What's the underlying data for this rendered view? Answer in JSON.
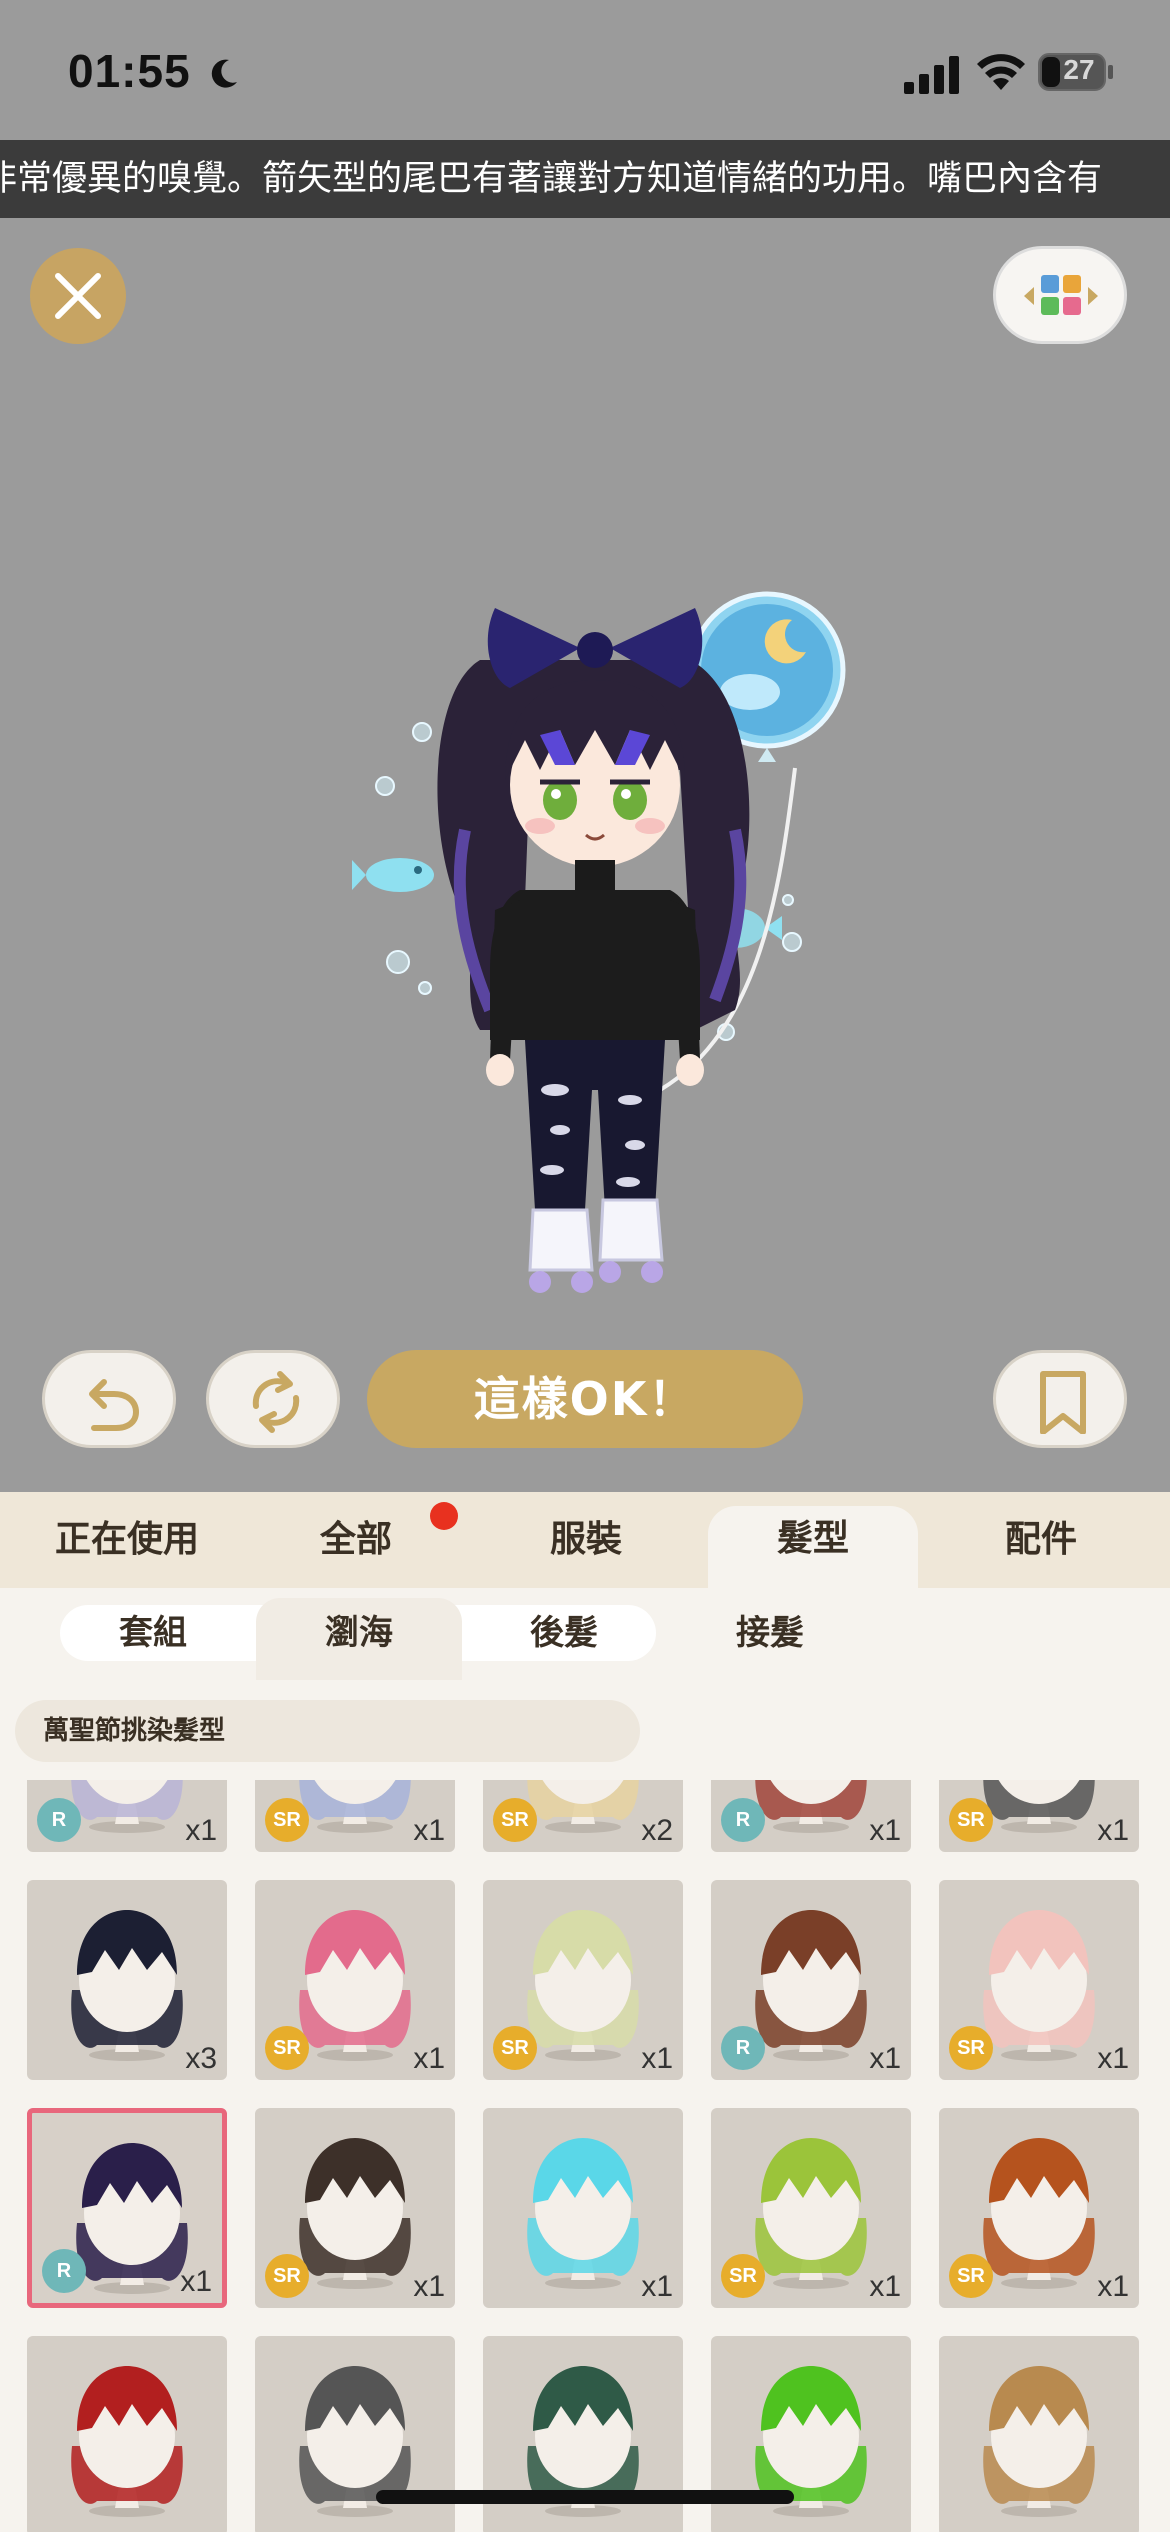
{
  "status_bar": {
    "time": "01:55",
    "battery_level": "27",
    "icons": [
      "moon-icon",
      "signal-icon",
      "wifi-icon",
      "battery-icon"
    ]
  },
  "marquee": {
    "text": "非常優異的嗅覺。箭矢型的尾巴有著讓對方知道情緒的功用。嘴巴內含有"
  },
  "top_buttons": {
    "close_icon": "close-icon",
    "layout_icon": "color-grid-icon"
  },
  "actions": {
    "undo_icon": "undo-icon",
    "refresh_icon": "refresh-icon",
    "confirm_label": "這樣OK！",
    "bookmark_icon": "bookmark-icon"
  },
  "categories": [
    {
      "label": "正在使用",
      "active": false
    },
    {
      "label": "全部",
      "active": false,
      "has_notification": true
    },
    {
      "label": "服裝",
      "active": false
    },
    {
      "label": "髮型",
      "active": true
    },
    {
      "label": "配件",
      "active": false
    }
  ],
  "subcategories": [
    {
      "label": "套組",
      "active": false
    },
    {
      "label": "瀏海",
      "active": true
    },
    {
      "label": "後髮",
      "active": false
    },
    {
      "label": "接髮",
      "active": false
    }
  ],
  "filter": {
    "label": "萬聖節挑染髮型"
  },
  "items": [
    {
      "rarity": "R",
      "count": "x1",
      "hair_color": "#b8b4d6"
    },
    {
      "rarity": "SR",
      "count": "x1",
      "hair_color": "#a7b3d9"
    },
    {
      "rarity": "SR",
      "count": "x2",
      "hair_color": "#e6d2a0"
    },
    {
      "rarity": "R",
      "count": "x1",
      "hair_color": "#a0443a"
    },
    {
      "rarity": "SR",
      "count": "x1",
      "hair_color": "#555555"
    },
    {
      "rarity": "",
      "count": "x3",
      "hair_color": "#1c1f33"
    },
    {
      "rarity": "SR",
      "count": "x1",
      "hair_color": "#e36b8c"
    },
    {
      "rarity": "SR",
      "count": "x1",
      "hair_color": "#d7dca8"
    },
    {
      "rarity": "R",
      "count": "x1",
      "hair_color": "#7a3f28"
    },
    {
      "rarity": "SR",
      "count": "x1",
      "hair_color": "#f2c3bd"
    },
    {
      "rarity": "R",
      "count": "x1",
      "hair_color": "#2a1f4a",
      "selected": true
    },
    {
      "rarity": "SR",
      "count": "x1",
      "hair_color": "#3d3029"
    },
    {
      "rarity": "",
      "count": "x1",
      "hair_color": "#5ad7e8"
    },
    {
      "rarity": "SR",
      "count": "x1",
      "hair_color": "#9bc43a"
    },
    {
      "rarity": "SR",
      "count": "x1",
      "hair_color": "#b5531e"
    },
    {
      "rarity": "",
      "count": "",
      "hair_color": "#b21f1f"
    },
    {
      "rarity": "",
      "count": "",
      "hair_color": "#555555"
    },
    {
      "rarity": "",
      "count": "",
      "hair_color": "#2f5a47"
    },
    {
      "rarity": "",
      "count": "",
      "hair_color": "#4fc21f"
    },
    {
      "rarity": "",
      "count": "",
      "hair_color": "#b88a4f"
    }
  ],
  "colors": {
    "gold": "#c8a862",
    "selected_border": "#e8677c",
    "r_badge": "#6fb7b8",
    "sr_badge": "#e7ad2b"
  }
}
